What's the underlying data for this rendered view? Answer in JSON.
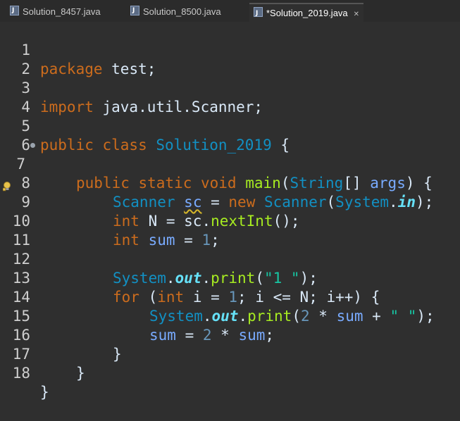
{
  "tabs": [
    {
      "label": "Solution_8457.java",
      "active": false
    },
    {
      "label": "Solution_8500.java",
      "active": false
    },
    {
      "label": "*Solution_2019.java",
      "active": true
    }
  ],
  "lines": [
    {
      "n": "1"
    },
    {
      "n": "2"
    },
    {
      "n": "3"
    },
    {
      "n": "4"
    },
    {
      "n": "5"
    },
    {
      "n": "6"
    },
    {
      "n": "7"
    },
    {
      "n": "8"
    },
    {
      "n": "9"
    },
    {
      "n": "10"
    },
    {
      "n": "11"
    },
    {
      "n": "12"
    },
    {
      "n": "13"
    },
    {
      "n": "14"
    },
    {
      "n": "15"
    },
    {
      "n": "16"
    },
    {
      "n": "17"
    },
    {
      "n": "18"
    }
  ],
  "code": {
    "l1": {
      "kw": "package",
      "rest": " test;"
    },
    "l3": {
      "kw": "import",
      "rest": " java.util.Scanner;"
    },
    "l5": {
      "kw": "public class",
      "cls": "Solution_2019",
      "rest": " {"
    },
    "l7": {
      "kw": "public static void",
      "mth": "main",
      "p1": "(",
      "cls": "String",
      "p2": "[] ",
      "var": "args",
      "p3": ") {"
    },
    "l8": {
      "cls1": "Scanner",
      "sp": " ",
      "var": "sc",
      "eq": " = ",
      "kw": "new",
      "sp2": " ",
      "cls2": "Scanner",
      "p1": "(",
      "cls3": "System",
      "dot": ".",
      "fld": "in",
      "p2": ");"
    },
    "l9": {
      "kw": "int",
      "rest1": " N = sc.",
      "mth": "nextInt",
      "rest2": "();"
    },
    "l10": {
      "kw": "int",
      "var": " sum",
      "eq": " = ",
      "num": "1",
      "end": ";"
    },
    "l12": {
      "cls": "System",
      "dot": ".",
      "fld": "out",
      "dot2": ".",
      "mth": "print",
      "p1": "(",
      "str": "\"1 \"",
      "p2": ");"
    },
    "l13": {
      "kw": "for",
      "p1": " (",
      "kw2": "int",
      "rest": " i = ",
      "num": "1",
      "rest2": "; i <= N; i++) {"
    },
    "l14": {
      "cls": "System",
      "dot": ".",
      "fld": "out",
      "dot2": ".",
      "mth": "print",
      "p1": "(",
      "num": "2",
      "op": " * ",
      "var": "sum",
      "op2": " + ",
      "str": "\" \"",
      "p2": ");"
    },
    "l15": {
      "var": "sum",
      "eq": " = ",
      "num": "2",
      "op": " * ",
      "var2": "sum",
      "end": ";"
    },
    "l16": {
      "br": "}"
    },
    "l17": {
      "br": "}"
    },
    "l18": {
      "br": "}"
    }
  },
  "colors": {
    "keyword": "#cc6c1d",
    "class": "#1290c3",
    "string": "#17c6a3",
    "method": "#a7ec21",
    "field": "#66e1f8",
    "variable": "#79abff",
    "background": "#2f2f2f"
  },
  "icons": {
    "tab_file": "java-file-icon",
    "tab_close": "close-icon",
    "gutter_line7": "override-indicator-icon",
    "gutter_line8": "warning-bulb-icon"
  }
}
